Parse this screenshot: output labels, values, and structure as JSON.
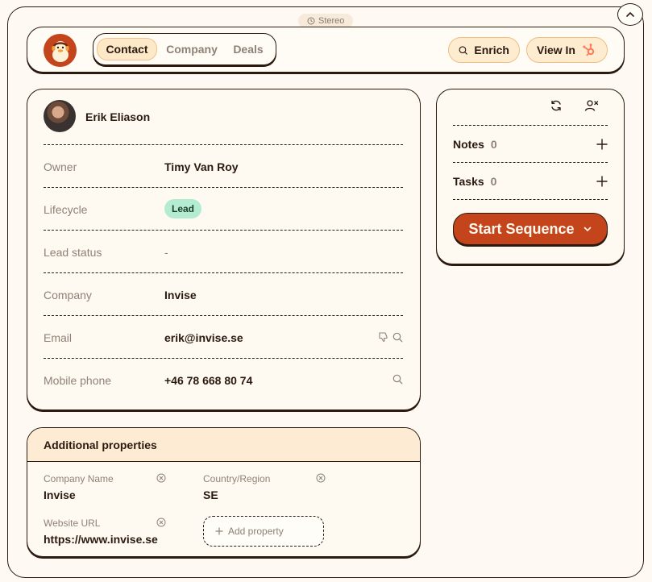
{
  "app": {
    "badge_label": "Stereo"
  },
  "tabs": [
    {
      "label": "Contact"
    },
    {
      "label": "Company"
    },
    {
      "label": "Deals"
    }
  ],
  "actions": {
    "enrich_label": "Enrich",
    "view_in_label": "View In"
  },
  "contact": {
    "name": "Erik Eliason",
    "properties": [
      {
        "label": "Owner",
        "value": "Timy Van Roy"
      },
      {
        "label": "Lifecycle",
        "value": "Lead"
      },
      {
        "label": "Lead status",
        "value": "-"
      },
      {
        "label": "Company",
        "value": "Invise"
      },
      {
        "label": "Email",
        "value": "erik@invise.se"
      },
      {
        "label": "Mobile phone",
        "value": "+46 78 668 80 74"
      }
    ]
  },
  "additional": {
    "title": "Additional properties",
    "items": [
      {
        "label": "Company Name",
        "value": "Invise"
      },
      {
        "label": "Country/Region",
        "value": "SE"
      },
      {
        "label": "Website URL",
        "value": "https://www.invise.se"
      }
    ],
    "add_label": "Add property"
  },
  "side": {
    "notes_label": "Notes",
    "notes_count": "0",
    "tasks_label": "Tasks",
    "tasks_count": "0",
    "sequence_label": "Start Sequence"
  },
  "colors": {
    "accent": "#c4451c",
    "background": "#fefaf3",
    "lead_badge": "#b4ecd2",
    "hubspot": "#ff7a59"
  },
  "icons": [
    "chevron-up-icon",
    "clock-icon",
    "search-icon",
    "hubspot-icon",
    "thumbs-down-icon",
    "refresh-icon",
    "remove-user-icon",
    "plus-icon",
    "close-circle-icon",
    "chevron-down-icon"
  ]
}
